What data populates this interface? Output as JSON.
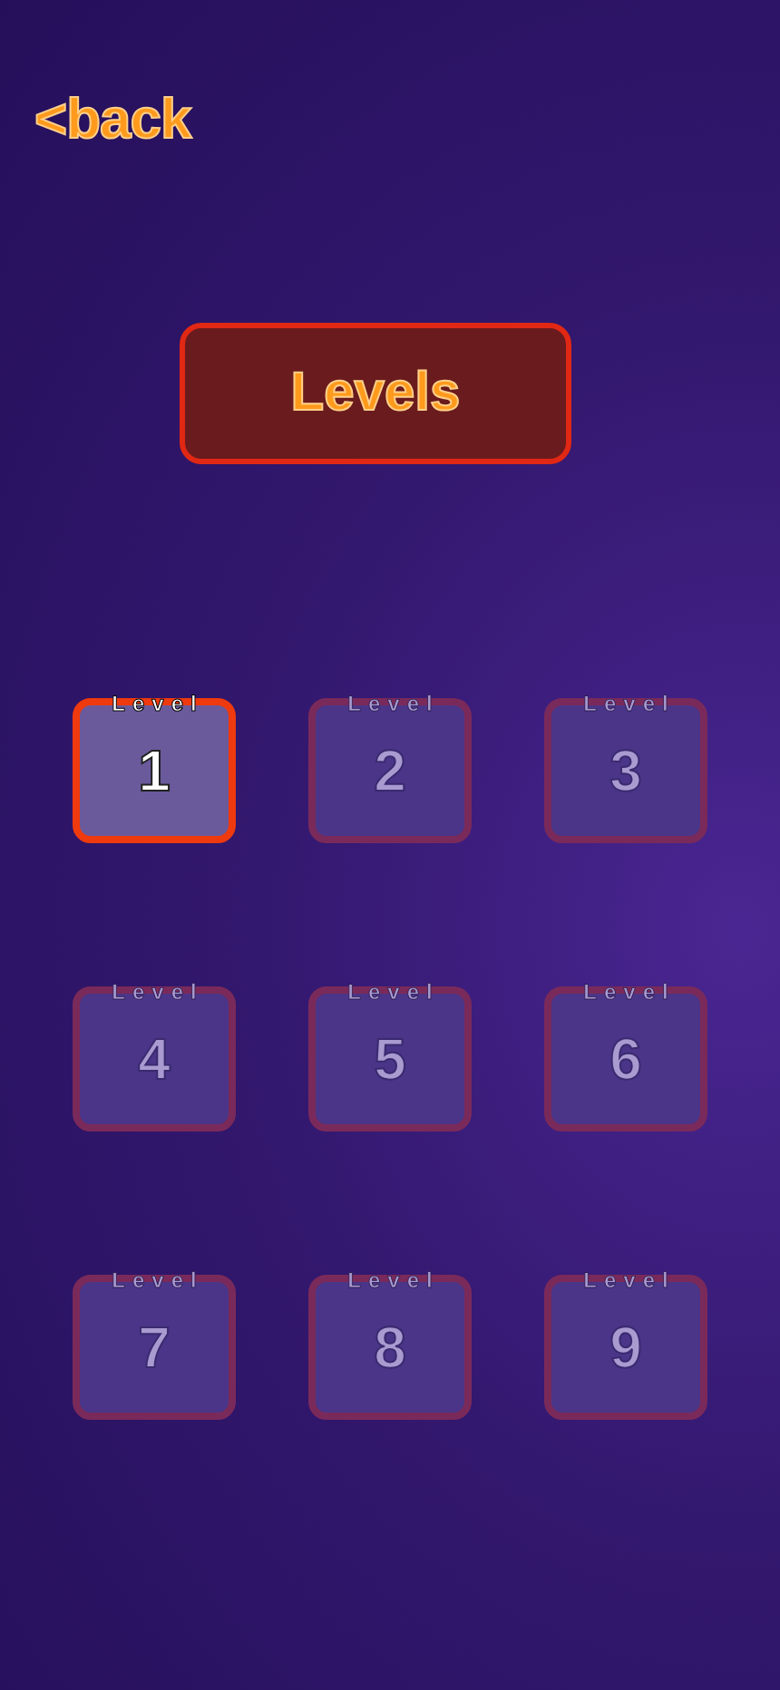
{
  "back_link": "<back",
  "title": "Levels",
  "levels": [
    {
      "caption": "Level",
      "number": "1",
      "disabled": false
    },
    {
      "caption": "Level",
      "number": "2",
      "disabled": true
    },
    {
      "caption": "Level",
      "number": "3",
      "disabled": true
    },
    {
      "caption": "Level",
      "number": "4",
      "disabled": true
    },
    {
      "caption": "Level",
      "number": "5",
      "disabled": true
    },
    {
      "caption": "Level",
      "number": "6",
      "disabled": true
    },
    {
      "caption": "Level",
      "number": "7",
      "disabled": true
    },
    {
      "caption": "Level",
      "number": "8",
      "disabled": true
    },
    {
      "caption": "Level",
      "number": "9",
      "disabled": true
    }
  ]
}
